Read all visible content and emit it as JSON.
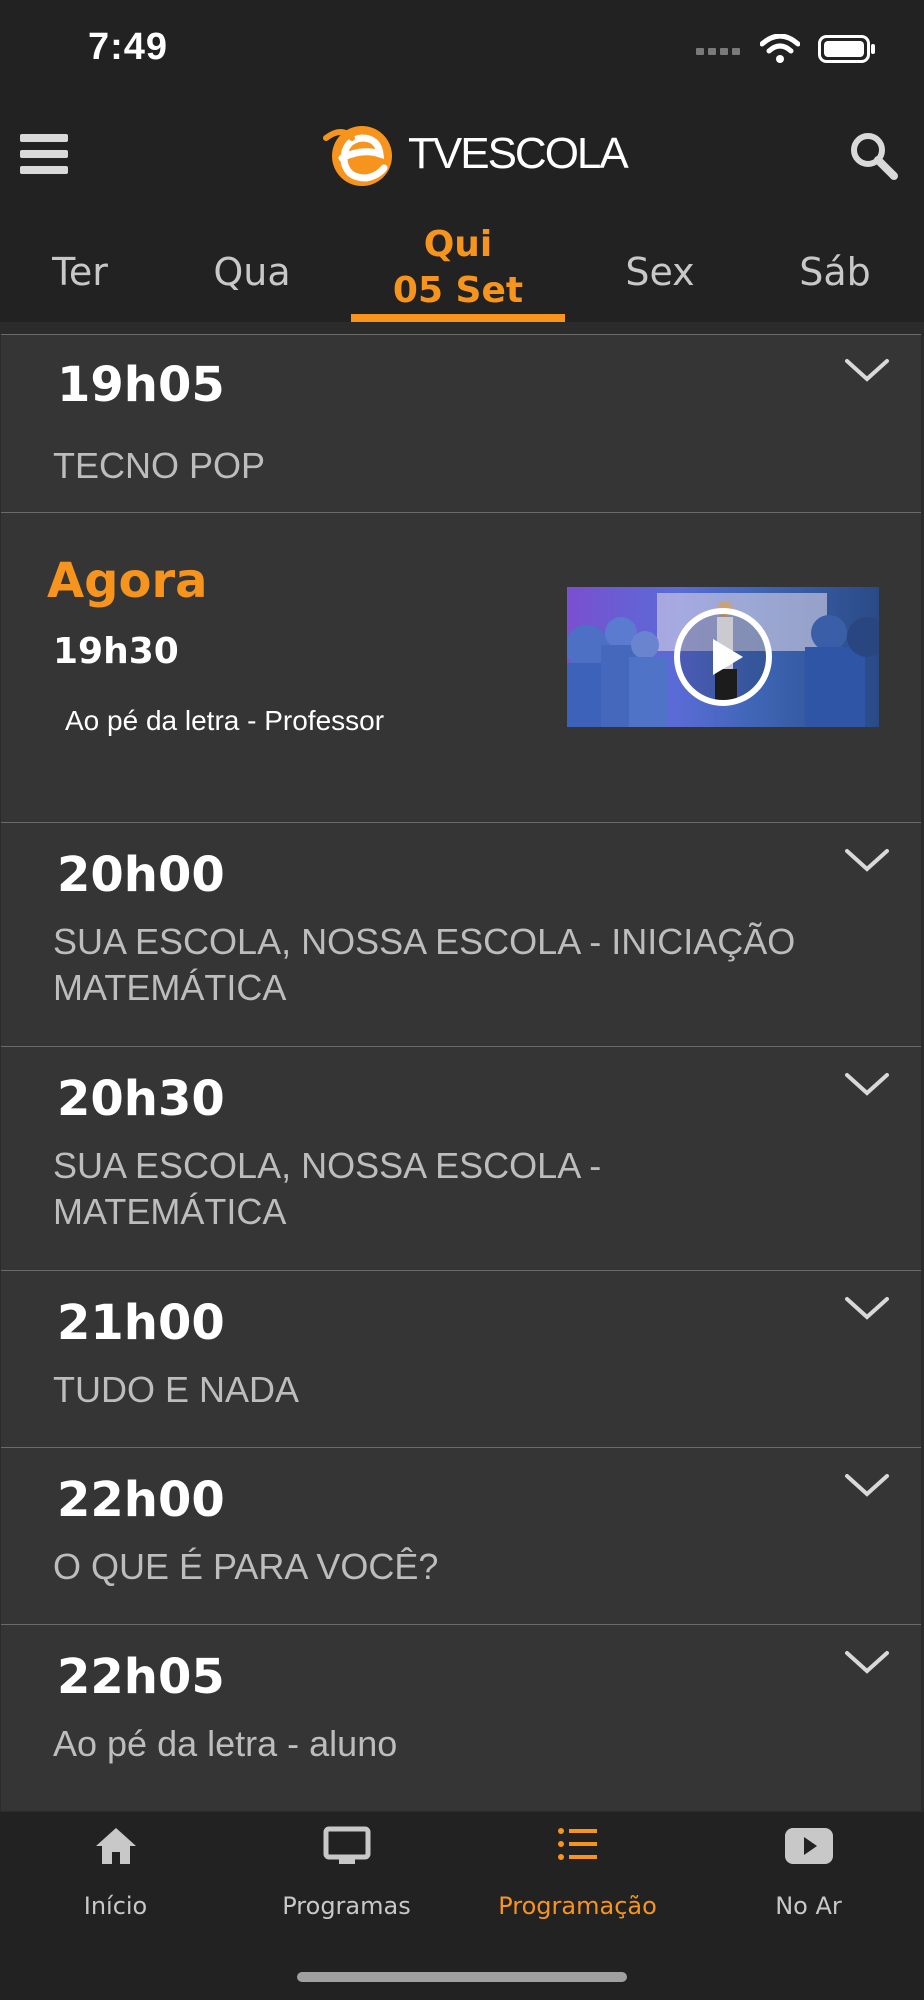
{
  "status": {
    "time": "7:49"
  },
  "header": {
    "logo_text": "TVESCOLA"
  },
  "days": [
    {
      "label": "Ter"
    },
    {
      "label": "Qua"
    },
    {
      "label": "Qui",
      "date": "05 Set"
    },
    {
      "label": "Sex"
    },
    {
      "label": "Sáb"
    }
  ],
  "schedule": {
    "items": [
      {
        "time": "19h05",
        "title": "TECNO POP"
      },
      {
        "time": "20h00",
        "title": "SUA ESCOLA, NOSSA ESCOLA - INICIAÇÃO MATEMÁTICA"
      },
      {
        "time": "20h30",
        "title": "SUA ESCOLA, NOSSA ESCOLA - MATEMÁTICA"
      },
      {
        "time": "21h00",
        "title": "TUDO E NADA"
      },
      {
        "time": "22h00",
        "title": "O QUE É PARA VOCÊ?"
      },
      {
        "time": "22h05",
        "title": "Ao pé da letra - aluno"
      }
    ],
    "now": {
      "label": "Agora",
      "time": "19h30",
      "title": "Ao pé da letra - Professor"
    }
  },
  "tabbar": {
    "items": [
      {
        "label": "Início",
        "icon": "home-icon"
      },
      {
        "label": "Programas",
        "icon": "tv-icon"
      },
      {
        "label": "Programação",
        "icon": "list-icon"
      },
      {
        "label": "No Ar",
        "icon": "play-icon"
      }
    ]
  },
  "colors": {
    "accent": "#f7941d",
    "background": "#2b2b2b",
    "row": "#353535",
    "bar": "#222222"
  }
}
